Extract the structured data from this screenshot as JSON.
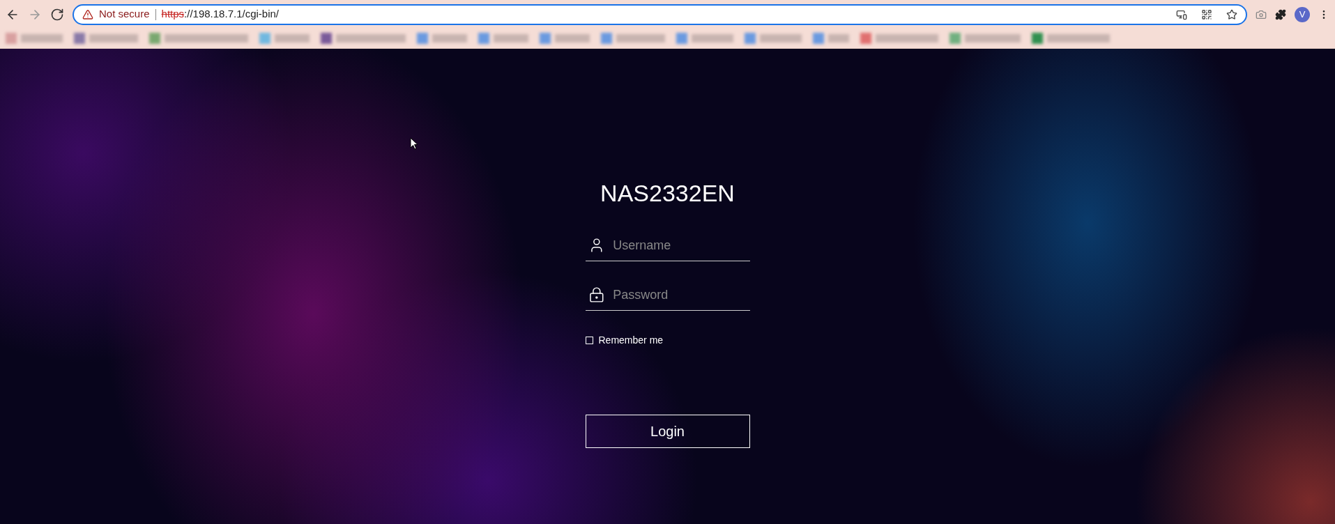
{
  "browser": {
    "security_label": "Not secure",
    "url_scheme": "https",
    "url_rest": "://198.18.7.1/cgi-bin/",
    "profile_initial": "V"
  },
  "login": {
    "title": "NAS2332EN",
    "username": {
      "placeholder": "Username"
    },
    "password": {
      "placeholder": "Password"
    },
    "remember": {
      "label": "Remember me",
      "checked": false
    },
    "button": "Login"
  }
}
